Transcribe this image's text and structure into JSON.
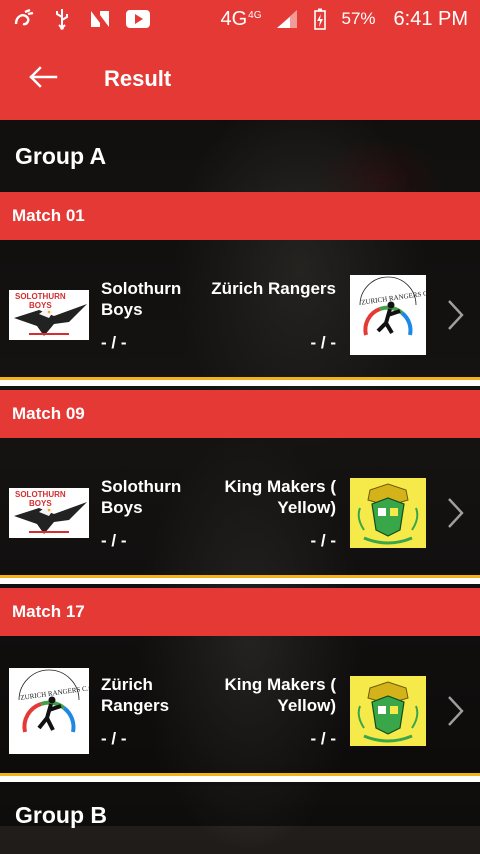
{
  "status_bar": {
    "network": "4G",
    "network_small": "4G",
    "battery": "57%",
    "time": "6:41 PM"
  },
  "app_bar": {
    "title": "Result"
  },
  "groups": [
    {
      "title": "Group A",
      "matches": [
        {
          "label": "Match 01",
          "team_a": "Solothurn Boys",
          "team_b": "Zürich Rangers",
          "score_a": "- / -",
          "score_b": "- / -"
        },
        {
          "label": "Match 09",
          "team_a": "Solothurn Boys",
          "team_b": "King Makers ( Yellow)",
          "score_a": "- / -",
          "score_b": "- / -"
        },
        {
          "label": "Match 17",
          "team_a": "Zürich Rangers",
          "team_b": "King Makers ( Yellow)",
          "score_a": "- / -",
          "score_b": "- / -"
        }
      ]
    },
    {
      "title": "Group B"
    }
  ],
  "colors": {
    "accent": "#e53935",
    "divider": "#f2b21a"
  }
}
